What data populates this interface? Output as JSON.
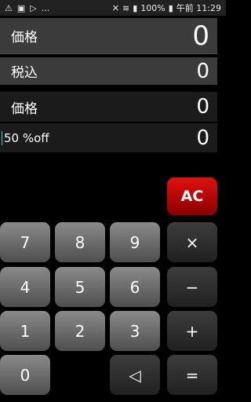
{
  "status": {
    "left_icons": [
      "warning-icon",
      "photo-icon",
      "play-icon"
    ],
    "dots": "...",
    "battery": "100%",
    "time": "午前 11:29"
  },
  "display": {
    "price_label": "価格",
    "price_value": "0",
    "tax_label": "税込",
    "tax_value": "0",
    "price2_label": "価格",
    "price2_value": "0",
    "discount_label": "50 %off",
    "discount_value": "0"
  },
  "keys": {
    "ac": "AC",
    "k7": "7",
    "k8": "8",
    "k9": "9",
    "mul": "×",
    "k4": "4",
    "k5": "5",
    "k6": "6",
    "minus": "−",
    "k1": "1",
    "k2": "2",
    "k3": "3",
    "plus": "+",
    "k0": "0",
    "back": "◁",
    "eq": "="
  },
  "colors": {
    "ac": "#d40000",
    "num": "#6e6e6e",
    "op": "#2a2a2a"
  }
}
